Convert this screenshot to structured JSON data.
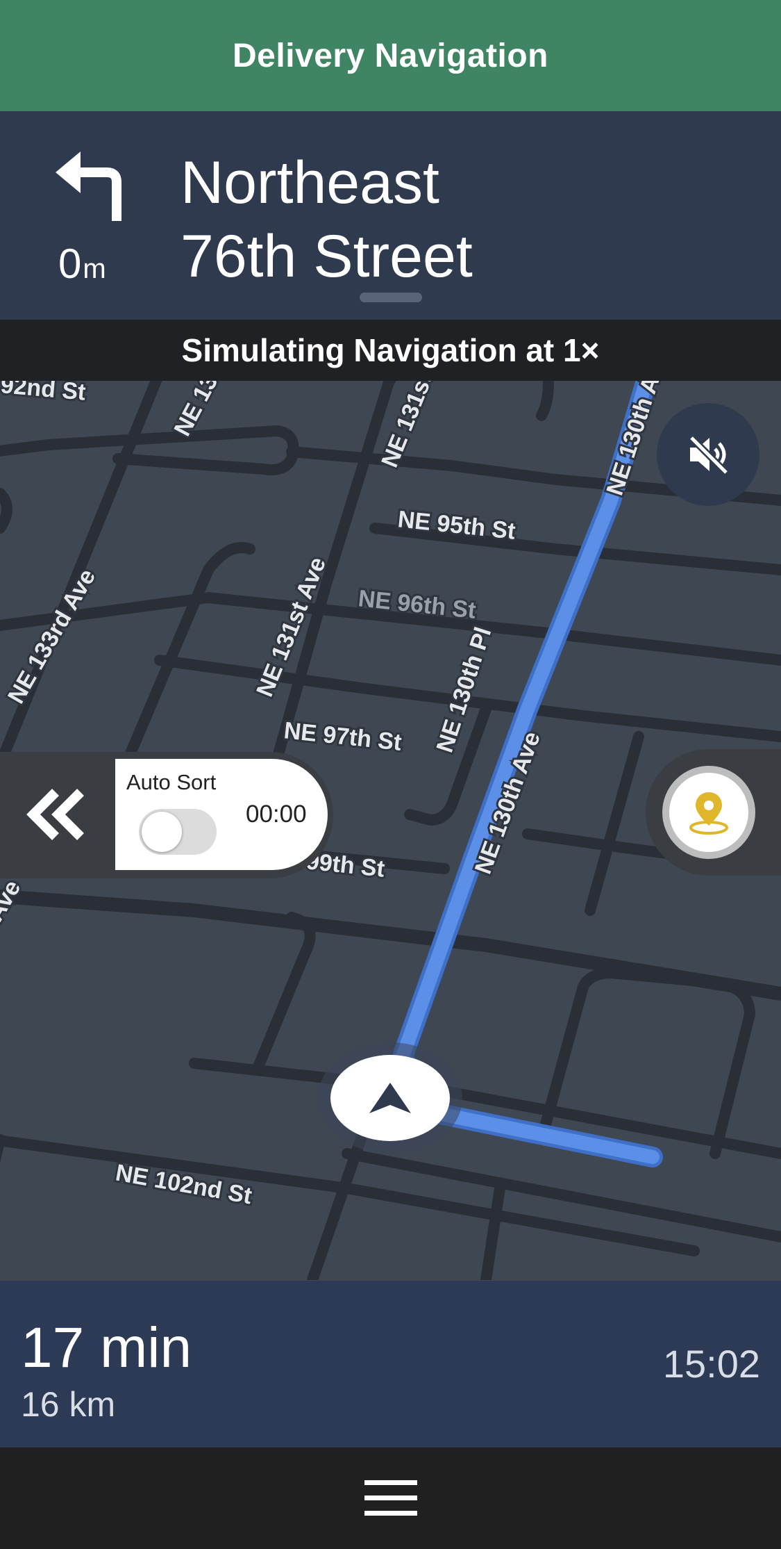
{
  "app_header": {
    "title": "Delivery Navigation"
  },
  "navigation": {
    "turn_direction": "left",
    "distance_value": "0",
    "distance_unit": "m",
    "street_line1": "Northeast",
    "street_line2": "76th Street"
  },
  "simulation_banner": {
    "text": "Simulating Navigation at 1×"
  },
  "map": {
    "street_labels": [
      "92nd St",
      "NE 133rd Ave",
      "NE 131st Ave",
      "NE 130th Ave",
      "NE 95th St",
      "NE 96th St",
      "NE 133rd Ave",
      "NE 131st Ave",
      "NE 130th Pl",
      "NE 97th St",
      "NE 130th Ave",
      "99th St",
      "Ave",
      "NE 102nd St"
    ],
    "route_color": "#5b8fe8"
  },
  "controls": {
    "mute_icon": "volume-muted-icon",
    "collapse_icon": "chevron-double-left-icon",
    "location_icon": "location-pin-icon"
  },
  "auto_sort": {
    "label": "Auto Sort",
    "timer": "00:00",
    "enabled": false
  },
  "trip": {
    "duration": "17 min",
    "distance": "16 km",
    "arrival_time": "15:02"
  },
  "bottom_bar": {
    "menu_icon": "hamburger-menu-icon"
  }
}
